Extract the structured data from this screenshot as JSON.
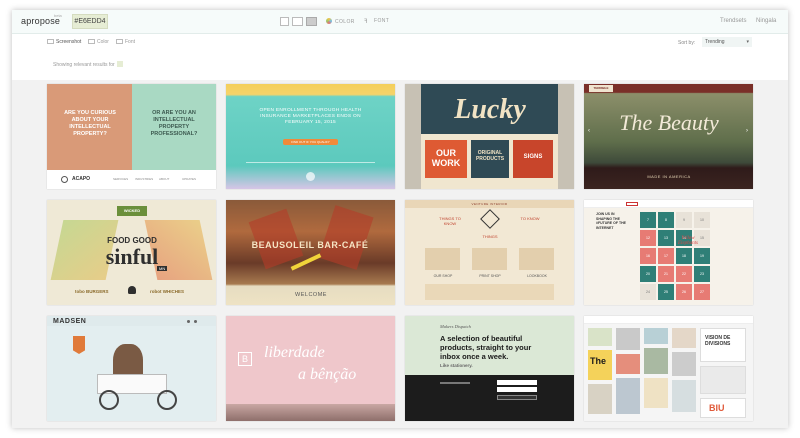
{
  "app": {
    "logo": "apropose",
    "logo_badge": "beta",
    "color_chip": "#E6EDD4",
    "tools": [
      {
        "label": "COLOR",
        "icon": "color-wheel-icon"
      },
      {
        "label": "FONT",
        "icon": "font-icon"
      }
    ],
    "nav": [
      "Trendsets",
      "Ningala"
    ],
    "accent": "#E6EDD4"
  },
  "filters": {
    "modes": [
      "Screenshot",
      "Color",
      "Font"
    ],
    "results_text": "Showing relevant results for",
    "sort_label": "Sort by:",
    "sort_value": "Trending"
  },
  "tiles": {
    "t1": {
      "left": "ARE YOU CURIOUS ABOUT YOUR INTELLECTUAL PROPERTY?",
      "right": "OR ARE YOU AN INTELLECTUAL PROPERTY PROFESSIONAL?",
      "brand": "ACAPO",
      "nav": [
        "SERVICES",
        "INDUSTRIES",
        "ABOUT",
        "UPDATES"
      ]
    },
    "t2": {
      "headline": "OPEN ENROLLMENT THROUGH HEALTH INSURANCE MARKETPLACES ENDS ON FEBRUARY 15, 2015",
      "cta": "FIND OUT IF YOU QUALIFY"
    },
    "t3": {
      "title": "Lucky",
      "our_work": "OUR WORK",
      "originals": "ORIGINAL PRODUCTS",
      "signs": "SIGNS"
    },
    "t4": {
      "badge": "TERRIBLE",
      "title": "The Beauty",
      "sub": "MADE IN AMERICA"
    },
    "t5": {
      "badge": "WICKED",
      "line1": "FOOD",
      "line2": "GOOD",
      "big": "sinful",
      "mn": "MN",
      "left": "tobo BURGERS",
      "right": "robot WHICHES"
    },
    "t6": {
      "title": "BEAUSOLEIL BAR-CAFÉ",
      "welcome": "WELCOME"
    },
    "t7": {
      "banner": "VENTURE INTERIOR",
      "items": [
        "THINGS TO KNOW",
        "TO KNOW",
        "THINGS",
        "OUR SHOP",
        "PRINT SHOP",
        "LOOKBOOK"
      ]
    },
    "t8": {
      "text": "JOIN US IN SHAPING THE #FUTURE OF THE INTERNET",
      "badge": "Yellow Elephants",
      "nums": [
        "7",
        "8",
        "9",
        "10",
        "12",
        "13",
        "14",
        "15",
        "16",
        "17",
        "18",
        "19",
        "20",
        "21",
        "22",
        "23",
        "24",
        "25",
        "26",
        "27",
        "28",
        "29",
        "30",
        "31"
      ]
    },
    "t9": {
      "brand": "MADSEN"
    },
    "t10": {
      "line1": "liberdade",
      "line2": "a bênção",
      "mark": "B"
    },
    "t11": {
      "brand": "Makers Dispatch",
      "headline": "A selection of beautiful products, straight to your inbox once a week.",
      "sub": "Like stationery."
    },
    "t12": {
      "poster1": "VISION DE DIVISIONS",
      "poster2": "The",
      "poster3": "BIU"
    }
  }
}
